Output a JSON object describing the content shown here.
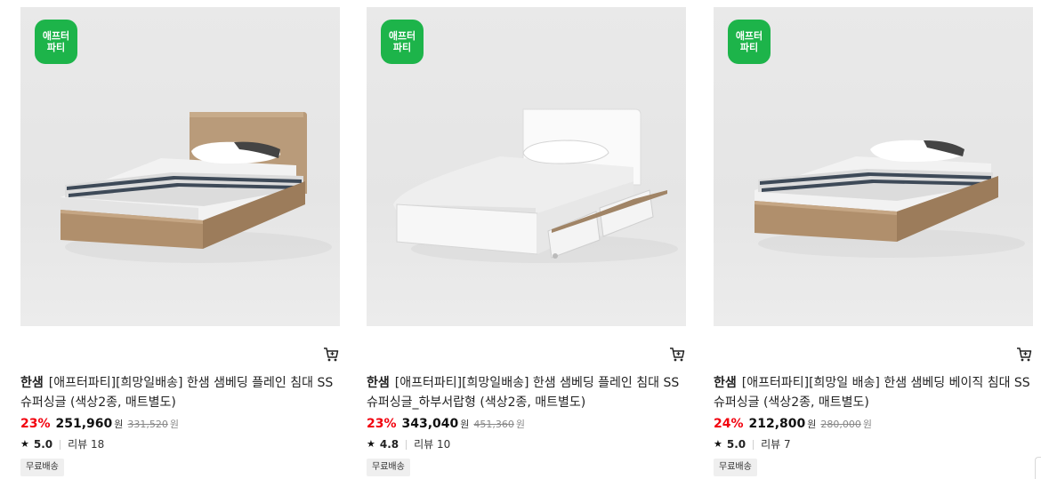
{
  "products": [
    {
      "badge": "애프터\n파티",
      "brand": "한샘",
      "title": "[애프터파티][희망일배송] 한샘 샘베딩 플레인 침대 SS 슈퍼싱글 (색상2종, 매트별도)",
      "discount": "23%",
      "price": "251,960",
      "currency": "원",
      "original_price": "331,520",
      "original_currency": "원",
      "rating": "5.0",
      "reviews": "리뷰 18",
      "shipping": "무료배송",
      "image_icon": "bed-image"
    },
    {
      "badge": "애프터\n파티",
      "brand": "한샘",
      "title": "[애프터파티][희망일배송] 한샘 샘베딩 플레인 침대 SS 슈퍼싱글_하부서랍형 (색상2종, 매트별도)",
      "discount": "23%",
      "price": "343,040",
      "currency": "원",
      "original_price": "451,360",
      "original_currency": "원",
      "rating": "4.8",
      "reviews": "리뷰 10",
      "shipping": "무료배송",
      "image_icon": "bed-image"
    },
    {
      "badge": "애프터\n파티",
      "brand": "한샘",
      "title": "[애프터파티][희망일 배송] 한샘 샘베딩 베이직 침대 SS 슈퍼싱글 (색상2종, 매트별도)",
      "discount": "24%",
      "price": "212,800",
      "currency": "원",
      "original_price": "280,000",
      "original_currency": "원",
      "rating": "5.0",
      "reviews": "리뷰 7",
      "shipping": "무료배송",
      "image_icon": "bed-image"
    }
  ],
  "icons": {
    "cart": "cart-icon",
    "star": "star-icon"
  },
  "colors": {
    "badge_green": "#1db44a",
    "discount_red": "#f2000d",
    "shipping_bg": "#efefef"
  }
}
